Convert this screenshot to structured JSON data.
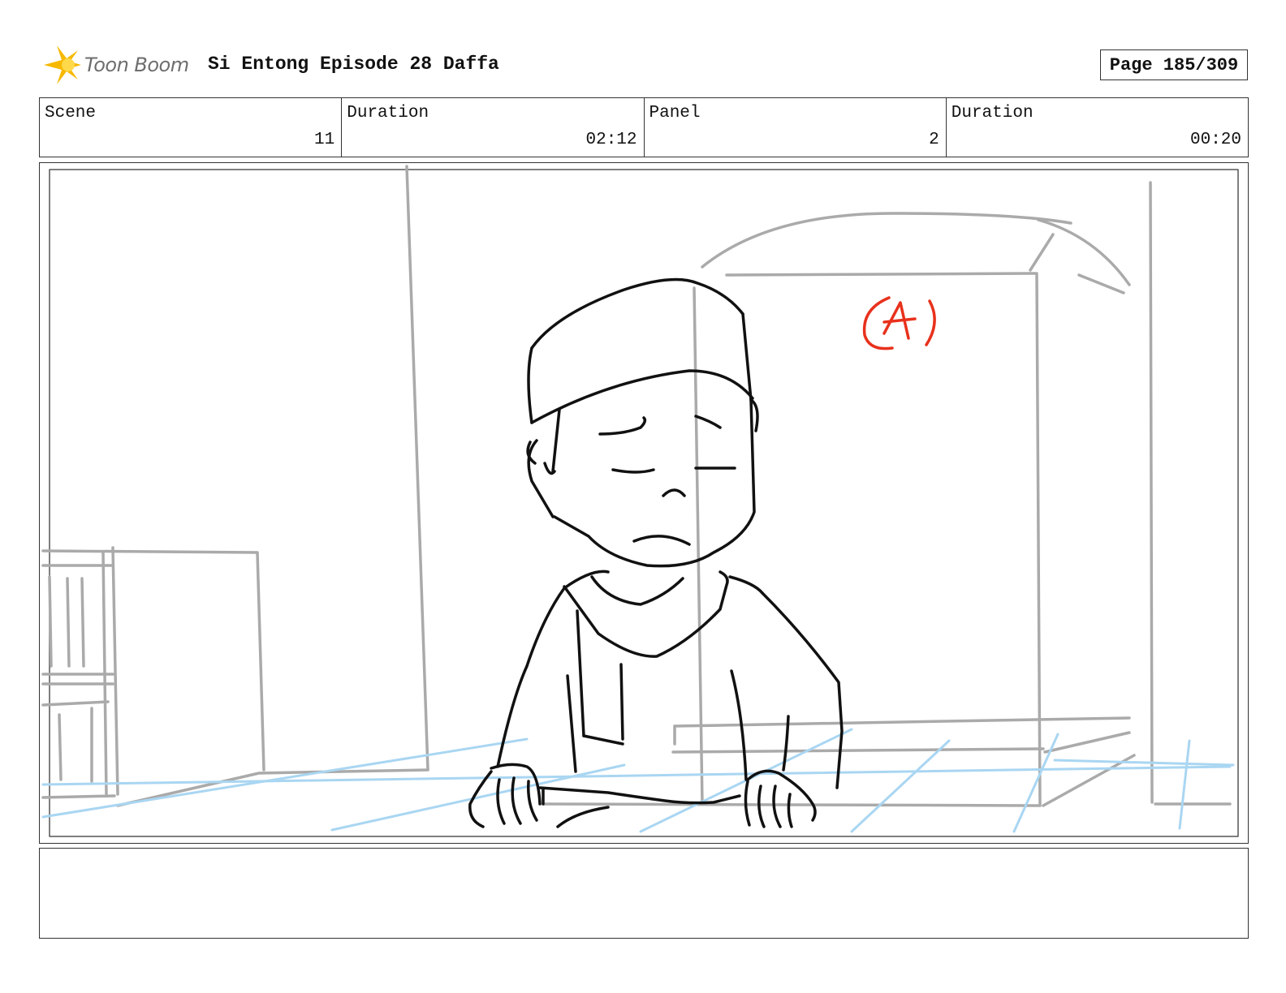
{
  "header": {
    "logo_text": "Toon Boom",
    "title": "Si Entong Episode 28 Daffa",
    "page": "Page 185/309"
  },
  "info": {
    "scene_label": "Scene",
    "scene_value": "11",
    "scene_duration_label": "Duration",
    "scene_duration_value": "02:12",
    "panel_label": "Panel",
    "panel_value": "2",
    "panel_duration_label": "Duration",
    "panel_duration_value": "00:20"
  },
  "frame": {
    "annotation": "(A)"
  },
  "colors": {
    "sketch_gray": "#aaaaaa",
    "sketch_black": "#111111",
    "sketch_blue": "#a9d6f2",
    "annotation_red": "#e8311c",
    "logo_yellow": "#f7b800"
  },
  "notes": {
    "text": ""
  }
}
